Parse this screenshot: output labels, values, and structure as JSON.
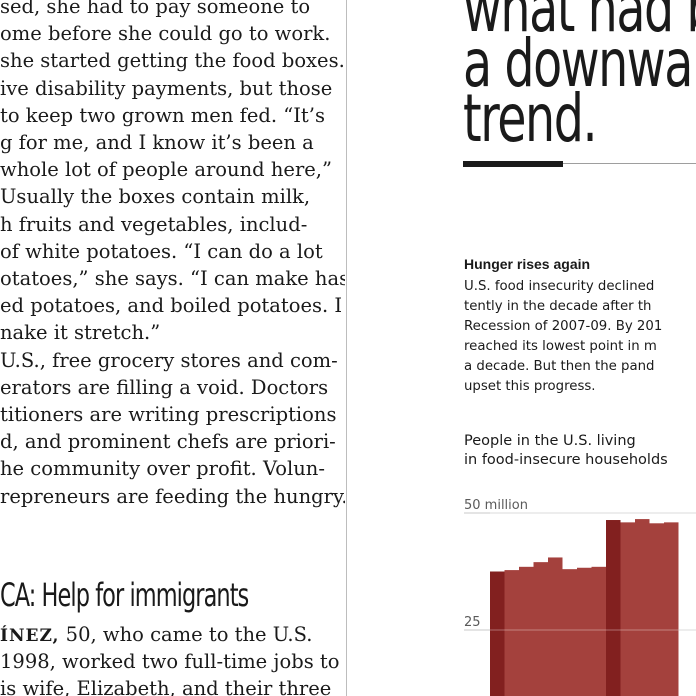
{
  "article": {
    "lines": [
      "sed, she had to pay someone to",
      "ome before she could go to work.",
      "she started getting the food boxes.",
      "ive disability payments, but those",
      "to keep two grown men fed. “It’s",
      "g for me, and I know it’s been a",
      "whole lot of people around here,”",
      "Usually the boxes contain milk,",
      "h fruits and vegetables, includ-",
      "of white potatoes. “I can do a lot",
      "otatoes,” she says. “I can make hash",
      "ed potatoes, and boiled potatoes. I",
      "nake it stretch.”",
      "U.S., free grocery stores and com-",
      "erators are filling a void. Doctors",
      "titioners are writing prescriptions",
      "d, and prominent chefs are priori-",
      "he community over profit. Volun-",
      "repreneurs are feeding the hungry."
    ],
    "subhead": "CA: Help for immigrants",
    "after_lines": {
      "name": "ÍNEZ,",
      "rest1": " 50, who came to the U.S.",
      "line2": " 1998, worked two full-time jobs to",
      "line3": "is wife, Elizabeth, and their three"
    }
  },
  "pull_quote": {
    "lines": [
      "what had bee",
      "a downward",
      "trend."
    ]
  },
  "sidebar": {
    "title": "Hunger rises again",
    "lines": [
      "U.S. food insecurity declined",
      "tently in the decade after th",
      "Recession of 2007-09. By 201",
      "reached its lowest point in m",
      "a decade. But then the pand",
      "upset this progress."
    ]
  },
  "chart_data": {
    "type": "bar",
    "title": "People in the U.S. living in food-insecure households",
    "title_lines": [
      "People in the U.S. living",
      "in food-insecure households"
    ],
    "ytick_labels": [
      "50 million",
      "25"
    ],
    "yticks": [
      50,
      25
    ],
    "ylim": [
      0,
      50
    ],
    "values": [
      37.5,
      37.8,
      38.5,
      39.5,
      40.5,
      38.0,
      38.3,
      38.5,
      48.5,
      48.0,
      48.7,
      47.8,
      48.0
    ],
    "highlight_indices": [
      0,
      8
    ],
    "colors": {
      "bar": "#a4413d",
      "highlight": "#82201f"
    },
    "grid": true
  }
}
